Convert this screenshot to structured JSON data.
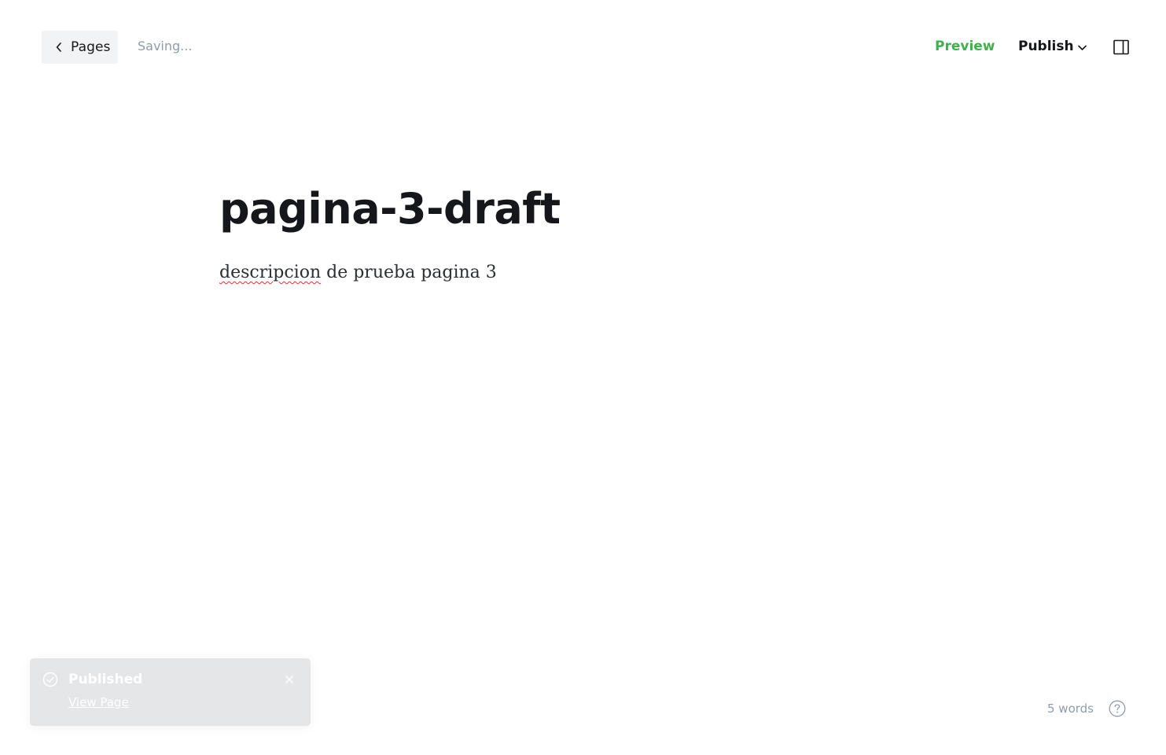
{
  "header": {
    "back_label": "Pages",
    "status": "Saving...",
    "preview_label": "Preview",
    "publish_label": "Publish"
  },
  "editor": {
    "title": "pagina-3-draft",
    "body_misspelled_word": "descripcion",
    "body_rest": " de prueba pagina 3"
  },
  "toast": {
    "title": "Published",
    "link_label": "View Page"
  },
  "footer": {
    "word_count": "5 words"
  },
  "colors": {
    "accent_green": "#3eb04f",
    "muted_text": "#8e9cac",
    "toast_bg": "#e5e6e7",
    "back_button_bg": "#f1f3f4"
  },
  "icons": {
    "back": "chevron-left-icon",
    "publish_dropdown": "chevron-down-icon",
    "sidebar": "sidebar-toggle-icon",
    "toast_status": "check-circle-icon",
    "toast_close": "close-icon",
    "help": "help-icon"
  }
}
